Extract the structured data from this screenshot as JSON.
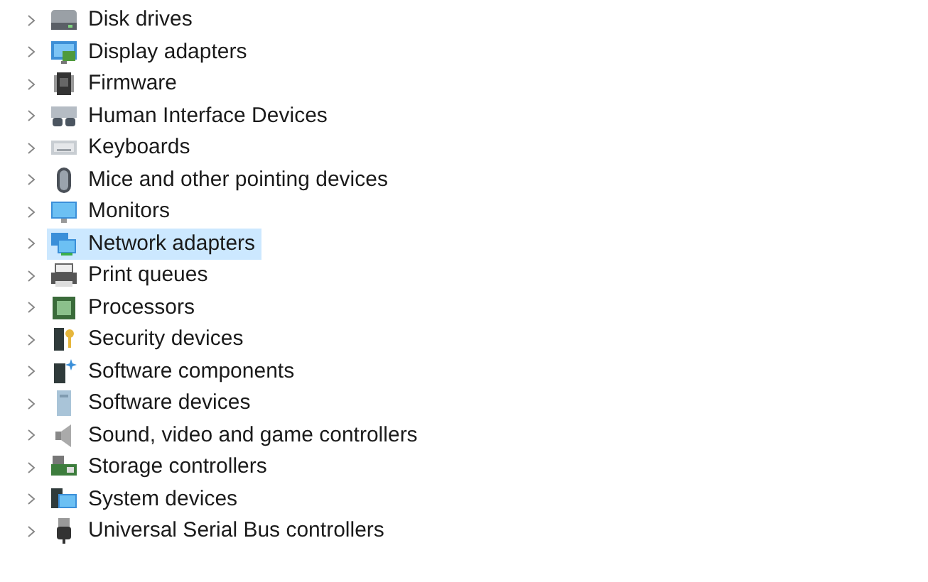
{
  "tree": {
    "items": [
      {
        "label": "Disk drives",
        "kind": "disk",
        "selected": false
      },
      {
        "label": "Display adapters",
        "kind": "display",
        "selected": false
      },
      {
        "label": "Firmware",
        "kind": "firmware",
        "selected": false
      },
      {
        "label": "Human Interface Devices",
        "kind": "hid",
        "selected": false
      },
      {
        "label": "Keyboards",
        "kind": "keyboard",
        "selected": false
      },
      {
        "label": "Mice and other pointing devices",
        "kind": "mouse",
        "selected": false
      },
      {
        "label": "Monitors",
        "kind": "monitor",
        "selected": false
      },
      {
        "label": "Network adapters",
        "kind": "network",
        "selected": true
      },
      {
        "label": "Print queues",
        "kind": "printer",
        "selected": false
      },
      {
        "label": "Processors",
        "kind": "processor",
        "selected": false
      },
      {
        "label": "Security devices",
        "kind": "security",
        "selected": false
      },
      {
        "label": "Software components",
        "kind": "softcomp",
        "selected": false
      },
      {
        "label": "Software devices",
        "kind": "softdev",
        "selected": false
      },
      {
        "label": "Sound, video and game controllers",
        "kind": "sound",
        "selected": false
      },
      {
        "label": "Storage controllers",
        "kind": "storage",
        "selected": false
      },
      {
        "label": "System devices",
        "kind": "system",
        "selected": false
      },
      {
        "label": "Universal Serial Bus controllers",
        "kind": "usb",
        "selected": false
      }
    ]
  }
}
